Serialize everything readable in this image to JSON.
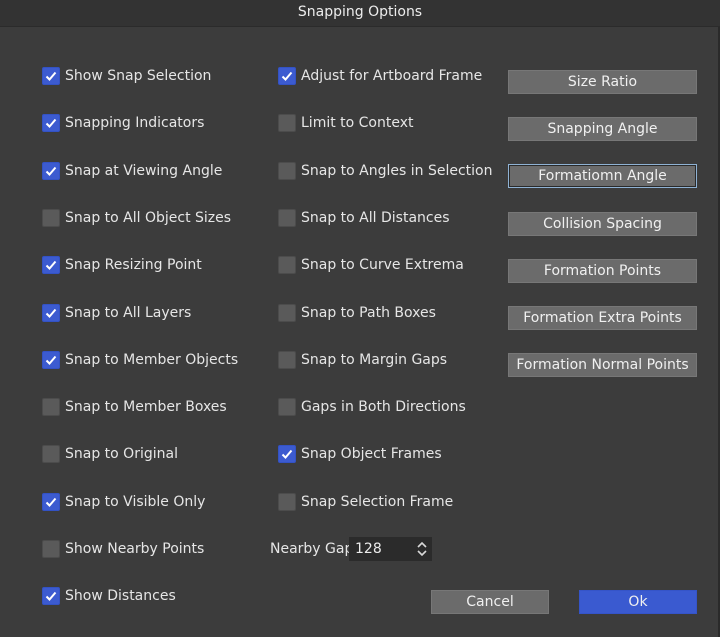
{
  "window": {
    "title": "Snapping Options"
  },
  "left_column": [
    {
      "label": "Show Snap Selection",
      "checked": true
    },
    {
      "label": "Snapping Indicators",
      "checked": true
    },
    {
      "label": "Snap at Viewing Angle",
      "checked": true
    },
    {
      "label": "Snap to All Object Sizes",
      "checked": false
    },
    {
      "label": "Snap Resizing Point",
      "checked": true
    },
    {
      "label": "Snap to All Layers",
      "checked": true
    },
    {
      "label": "Snap to Member Objects",
      "checked": true
    },
    {
      "label": "Snap to Member Boxes",
      "checked": false
    },
    {
      "label": "Snap to Original",
      "checked": false
    },
    {
      "label": "Snap to Visible Only",
      "checked": true
    },
    {
      "label": "Show Nearby Points",
      "checked": false
    },
    {
      "label": "Show Distances",
      "checked": true
    }
  ],
  "middle_column": [
    {
      "label": "Adjust for Artboard Frame",
      "checked": true
    },
    {
      "label": "Limit to Context",
      "checked": false
    },
    {
      "label": "Snap to Angles in Selection",
      "checked": false
    },
    {
      "label": "Snap to All Distances",
      "checked": false
    },
    {
      "label": "Snap to Curve Extrema",
      "checked": false
    },
    {
      "label": "Snap to Path Boxes",
      "checked": false
    },
    {
      "label": "Snap to Margin Gaps",
      "checked": false
    },
    {
      "label": "Gaps in Both Directions",
      "checked": false
    },
    {
      "label": "Snap Object Frames",
      "checked": true
    },
    {
      "label": "Snap Selection Frame",
      "checked": false
    }
  ],
  "side_buttons": [
    {
      "label": "Size Ratio",
      "focused": false
    },
    {
      "label": "Snapping Angle",
      "focused": false
    },
    {
      "label": "Formatiomn Angle",
      "focused": true
    },
    {
      "label": "Collision Spacing",
      "focused": false
    },
    {
      "label": "Formation Points",
      "focused": false
    },
    {
      "label": "Formation Extra Points",
      "focused": false
    },
    {
      "label": "Formation Normal Points",
      "focused": false
    }
  ],
  "nearby_gap": {
    "label": "Nearby Gap",
    "value": "128"
  },
  "footer": {
    "cancel_label": "Cancel",
    "ok_label": "Ok"
  },
  "colors": {
    "accent": "#3a5ad0",
    "background": "#3c3c3c",
    "button": "#6b6b6b"
  }
}
